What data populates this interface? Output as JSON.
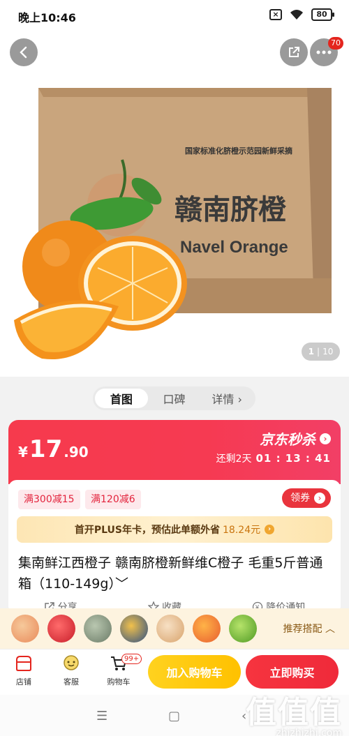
{
  "status_bar": {
    "time": "晚上10:46",
    "battery": "80"
  },
  "header": {
    "more_badge": "70"
  },
  "hero": {
    "box_slogan": "国家标准化脐橙示范园新鲜采摘",
    "box_title": "赣南脐橙",
    "box_subtitle": "Navel Orange",
    "pager_current": "1",
    "pager_total": "10"
  },
  "tabs": [
    {
      "label": "首图",
      "active": true
    },
    {
      "label": "口碑",
      "active": false
    },
    {
      "label": "详情 ›",
      "active": false
    }
  ],
  "price": {
    "currency": "¥",
    "integer": "17",
    "decimal": ".90"
  },
  "seckill": {
    "label": "京东秒杀",
    "countdown_prefix": "还剩2天",
    "countdown_time": "01 : 13 : 41"
  },
  "coupons": [
    {
      "label": "满300减15"
    },
    {
      "label": "满120减6"
    }
  ],
  "claim_button": "领券",
  "plus_bar": {
    "text": "首开PLUS年卡，预估此单额外省",
    "amount": "18.24元"
  },
  "product_title": "集南鲜江西橙子 赣南脐橙新鲜维C橙子 毛重5斤普通箱（110-149g）﹀",
  "actions": [
    {
      "label": "分享",
      "icon": "share-icon"
    },
    {
      "label": "收藏",
      "icon": "star-icon"
    },
    {
      "label": "降价通知",
      "icon": "price-drop-icon"
    }
  ],
  "recommend": {
    "label": "推荐搭配 ︿"
  },
  "bottom_bar": {
    "shop": "店铺",
    "service": "客服",
    "cart": "购物车",
    "cart_badge": "99+",
    "add_to_cart": "加入购物车",
    "buy_now": "立即购买"
  },
  "watermark": {
    "big": "值值值",
    "small": "zhizhizhi.com"
  },
  "colors": {
    "accent_red": "#f63a4d",
    "yellow": "#ffc100",
    "plus_gold": "#fde6b4"
  }
}
